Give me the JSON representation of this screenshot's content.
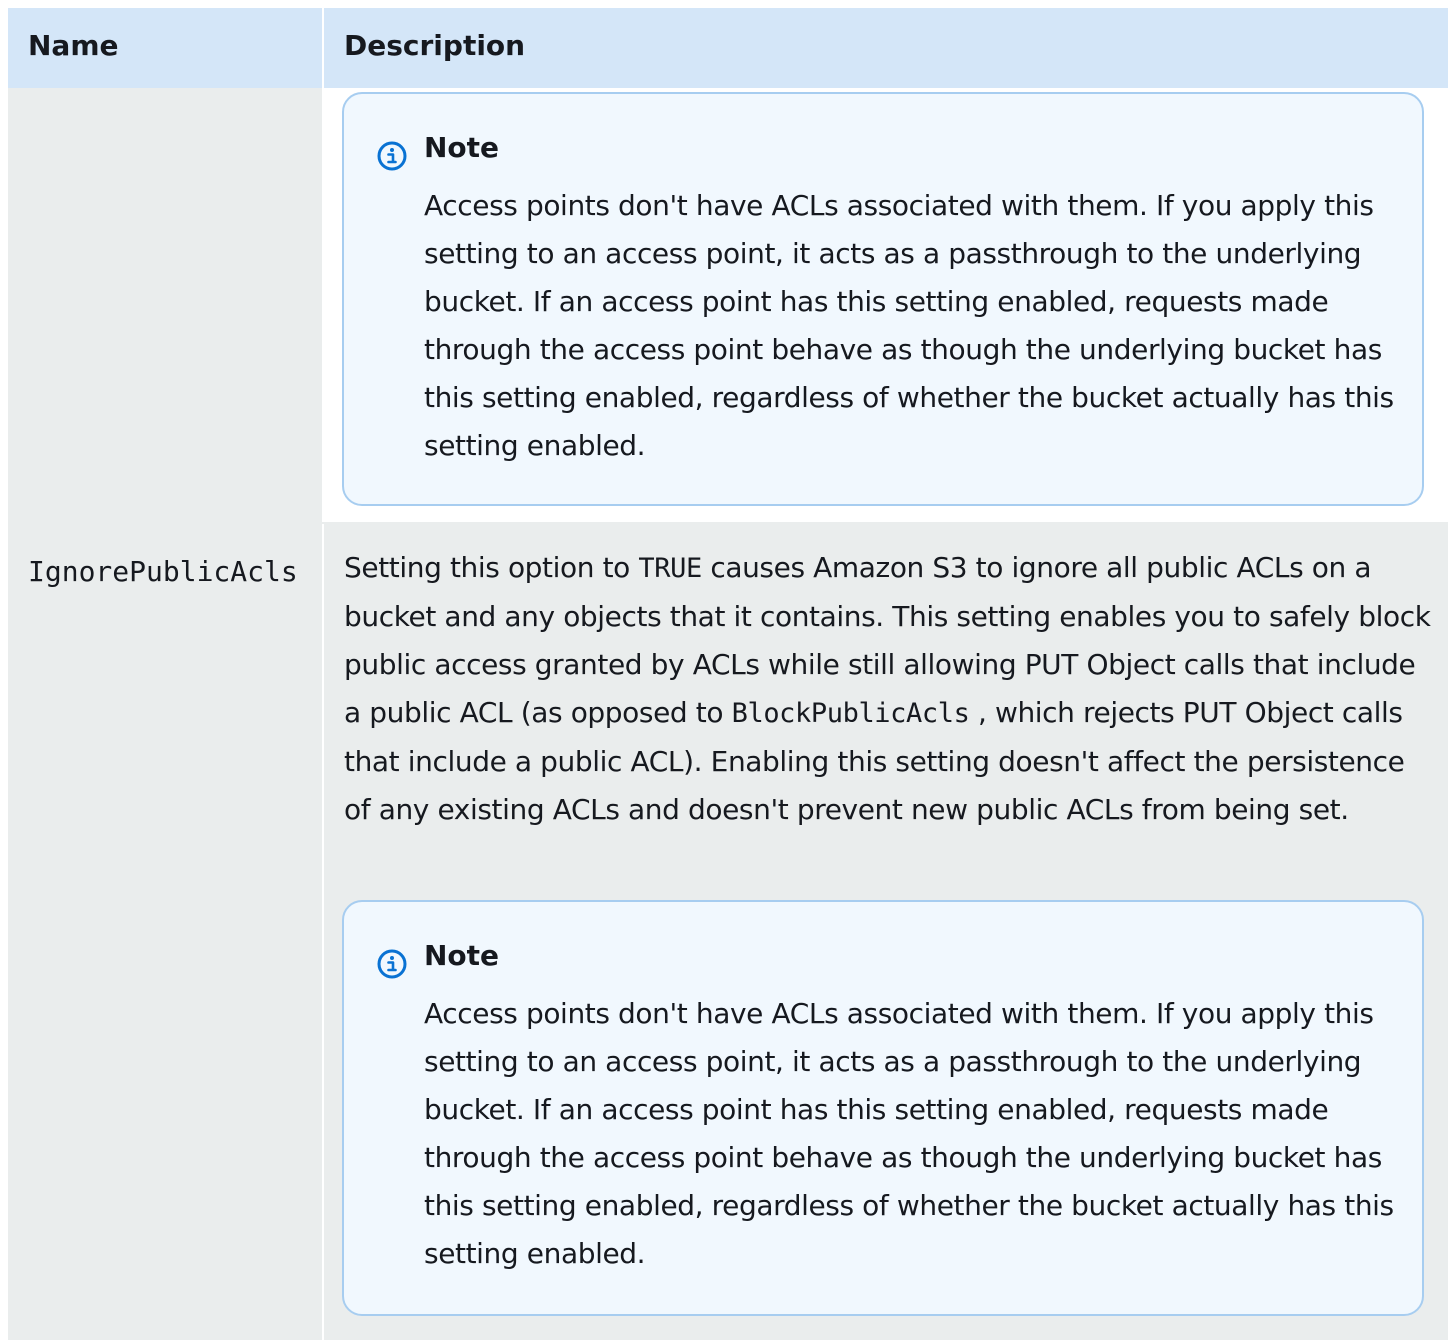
{
  "table": {
    "header": {
      "name": "Name",
      "description": "Description"
    },
    "rows": [
      {
        "name": "",
        "description": "",
        "note": {
          "title": "Note",
          "body": "Access points don't have ACLs associated with them. If you  apply this setting to an access point, it acts as a passthrough to the  underlying bucket. If an access point has this setting enabled, requests  made through the access point behave as though the underlying bucket has  this setting enabled, regardless of whether the bucket actually  has this setting enabled."
        }
      },
      {
        "name": "IgnorePublicAcls",
        "description_part1": "Setting this option to ",
        "description_code1": "TRUE",
        "description_part2": " causes Amazon S3 to ignore all  public ACLs on a bucket and any objects that it contains. This  setting enables you to safely block public access granted by ACLs  while still allowing PUT Object calls that include a public ACL (as  opposed to ",
        "description_code2": "BlockPublicAcls",
        "description_part3": " , which rejects PUT Object  calls that include a public ACL). Enabling this setting doesn't  affect the persistence of any existing ACLs and doesn't prevent new  public ACLs from being set.",
        "note": {
          "title": "Note",
          "body": "Access points don't have ACLs associated with them. If you  apply this setting to an access point, it acts as a passthrough to the  underlying bucket. If an access point has this setting enabled, requests  made through the access point behave as though the underlying bucket has  this setting enabled, regardless of whether the bucket actually  has this setting enabled."
        }
      }
    ]
  },
  "colors": {
    "header_bg": "#d4e6f8",
    "name_cell_bg": "#eaeded",
    "note_bg": "#f1f8fe",
    "note_border": "#a7cdf0",
    "info_icon": "#0972d3"
  },
  "icons": {
    "note": "info-icon"
  }
}
